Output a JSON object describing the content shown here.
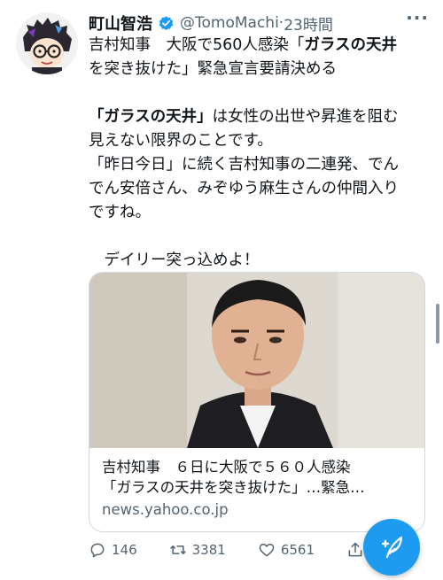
{
  "tweet": {
    "author_name": "町山智浩",
    "author_handle": "@TomoMachi",
    "separator": "·",
    "timestamp": "23時間",
    "more_label": "···",
    "body": {
      "line1": "吉村知事　大阪で560人感染「",
      "line1_bold": "ガラスの天井",
      "line2": "を突き抜けた」緊急宣言要請決める",
      "line3_bold": "「ガラスの天井」",
      "line3": "は女性の出世や昇進を阻む",
      "line4": "見えない限界のことです。",
      "line5": "「昨日今日」に続く吉村知事の二連発、でん",
      "line6": "でん安倍さん、みぞゆう麻生さんの仲間入り",
      "line7": "ですね。",
      "line8": "　デイリー突っ込めよ！"
    },
    "card": {
      "title_line1": "吉村知事　６日に大阪で５６０人感染",
      "title_line2": "「ガラスの天井を突き抜けた」…緊急…",
      "domain": "news.yahoo.co.jp"
    },
    "stats": {
      "replies": "146",
      "retweets": "3381",
      "likes": "6561"
    }
  },
  "colors": {
    "accent": "#1d9bf0",
    "secondary_text": "#536471",
    "border": "#cfd9de"
  }
}
